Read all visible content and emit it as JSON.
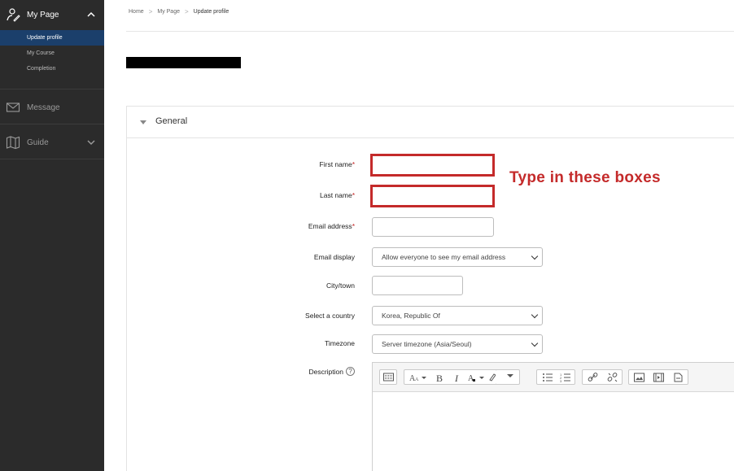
{
  "sidebar": {
    "mypage_label": "My Page",
    "items": [
      {
        "label": "Update profile",
        "active": true
      },
      {
        "label": "My Course",
        "active": false
      },
      {
        "label": "Completion",
        "active": false
      }
    ],
    "message_label": "Message",
    "guide_label": "Guide"
  },
  "breadcrumb": {
    "home": "Home",
    "mypage": "My Page",
    "current": "Update profile",
    "separator": ">"
  },
  "section": {
    "title": "General"
  },
  "form": {
    "required_mark": "*",
    "first_name": {
      "label": "First name",
      "value": ""
    },
    "last_name": {
      "label": "Last name",
      "value": ""
    },
    "email": {
      "label": "Email address",
      "value": ""
    },
    "email_display": {
      "label": "Email display",
      "selected": "Allow everyone to see my email address"
    },
    "city": {
      "label": "City/town",
      "value": ""
    },
    "country": {
      "label": "Select a country",
      "selected": "Korea, Republic Of"
    },
    "timezone": {
      "label": "Timezone",
      "selected": "Server timezone (Asia/Seoul)"
    },
    "description": {
      "label": "Description",
      "help": "?"
    }
  },
  "annotation": "Type in these boxes",
  "colors": {
    "sidebar_bg": "#2b2b2b",
    "active_item": "#1b3f6b",
    "annotation_red": "#c42a2a",
    "required_red": "#c12323"
  },
  "icons": {
    "mypage": "person-icon",
    "message": "envelope-icon",
    "guide": "book-map-icon"
  }
}
